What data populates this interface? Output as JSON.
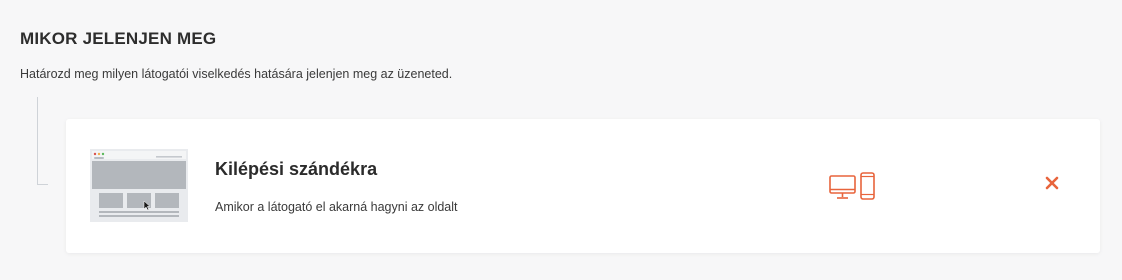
{
  "section": {
    "title": "MIKOR JELENJEN MEG",
    "description": "Határozd meg milyen látogatói viselkedés hatására jelenjen meg az üzeneted."
  },
  "trigger_card": {
    "title": "Kilépési szándékra",
    "description": "Amikor a látogató el akarná hagyni az oldalt",
    "thumbnail_icon": "exit-intent-preview-icon",
    "device_icons": [
      "desktop-icon",
      "mobile-icon"
    ],
    "remove_icon": "close-icon"
  },
  "colors": {
    "accent": "#e8643c",
    "background": "#f7f7f8",
    "card": "#ffffff",
    "tree_line": "#cfd3d8"
  }
}
